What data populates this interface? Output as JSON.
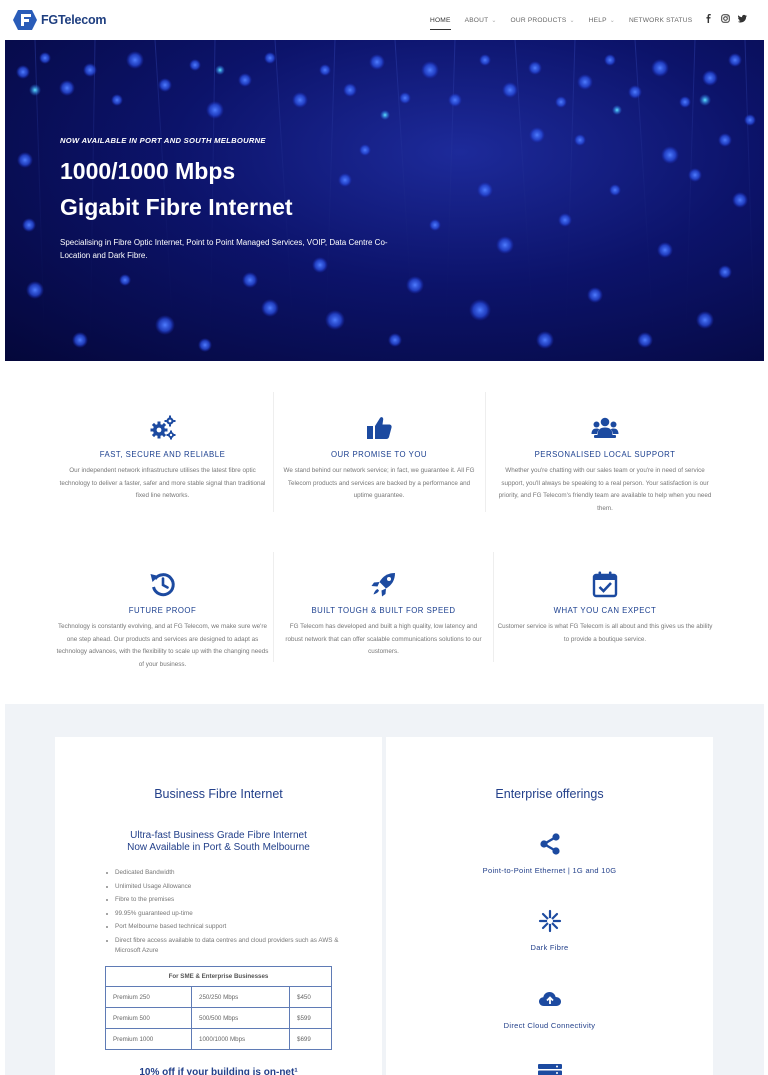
{
  "header": {
    "brand": "FGTelecom",
    "nav": [
      {
        "label": "HOME",
        "caret": false
      },
      {
        "label": "ABOUT",
        "caret": true
      },
      {
        "label": "OUR PRODUCTS",
        "caret": true
      },
      {
        "label": "HELP",
        "caret": true
      },
      {
        "label": "NETWORK STATUS",
        "caret": false
      }
    ],
    "social_icons": [
      "facebook-icon",
      "instagram-icon",
      "twitter-icon"
    ]
  },
  "hero": {
    "kicker": "NOW AVAILABLE IN PORT AND SOUTH MELBOURNE",
    "title_line1": "1000/1000 Mbps",
    "title_line2": "Gigabit Fibre Internet",
    "subtitle": "Specialising in Fibre Optic Internet, Point to Point Managed Services, VOIP, Data Centre Co-Location and Dark Fibre."
  },
  "features": [
    {
      "icon": "gears-icon",
      "title": "FAST, SECURE AND RELIABLE",
      "text": "Our independent network infrastructure utilises the latest fibre optic technology to deliver a faster, safer and more stable signal than traditional fixed line networks."
    },
    {
      "icon": "thumbs-up-icon",
      "title": "OUR PROMISE TO YOU",
      "text": "We stand behind our network service; in fact, we guarantee it. All FG Telecom products and services are backed by a performance and uptime guarantee."
    },
    {
      "icon": "users-icon",
      "title": "PERSONALISED LOCAL SUPPORT",
      "text": "Whether you're chatting with our sales team or you're in need of service support, you'll always be speaking to a real person. Your satisfaction is our priority, and FG Telecom's friendly team are available to help when you need them."
    },
    {
      "icon": "history-icon",
      "title": "FUTURE PROOF",
      "text": "Technology is constantly evolving, and at FG Telecom, we make sure we're one step ahead. Our products and services are designed to adapt as technology advances, with the flexibility to scale up with the changing needs of your business."
    },
    {
      "icon": "rocket-icon",
      "title": "BUILT TOUGH & BUILT FOR SPEED",
      "text": "FG Telecom has developed and built a high quality, low latency and robust network that can offer scalable communications solutions to our customers."
    },
    {
      "icon": "calendar-check-icon",
      "title": "WHAT YOU CAN EXPECT",
      "text": "Customer service is what FG Telecom is all about and this gives us the ability to provide a boutique service."
    }
  ],
  "business": {
    "title": "Business Fibre Internet",
    "subtitle_line1": "Ultra-fast Business Grade Fibre Internet",
    "subtitle_line2": "Now Available in Port & South Melbourne",
    "bullets": [
      "Dedicated Bandwidth",
      "Unlimited Usage Allowance",
      "Fibre to the premises",
      "99.95% guaranteed up-time",
      "Port Melbourne based technical support",
      "Direct fibre access available to data centres and cloud providers such as AWS & Microsoft Azure"
    ],
    "table": {
      "header": "For SME & Enterprise Businesses",
      "rows": [
        [
          "Premium 250",
          "250/250 Mbps",
          "$450"
        ],
        [
          "Premium 500",
          "500/500 Mbps",
          "$599"
        ],
        [
          "Premium 1000",
          "1000/1000 Mbps",
          "$699"
        ]
      ]
    },
    "discount": "10% off if your building is on-net¹"
  },
  "enterprise": {
    "title": "Enterprise offerings",
    "items": [
      {
        "icon": "share-icon",
        "label": "Point-to-Point Ethernet | 1G and 10G"
      },
      {
        "icon": "asterisk-icon",
        "label": "Dark Fibre"
      },
      {
        "icon": "cloud-upload-icon",
        "label": "Direct Cloud Connectivity"
      },
      {
        "icon": "server-icon",
        "label": ""
      }
    ]
  },
  "colors": {
    "brand": "#1b3f8f",
    "icon": "#1c4aa0",
    "hero_bg": "#0c136a",
    "section_bg": "#f0f3f7"
  }
}
